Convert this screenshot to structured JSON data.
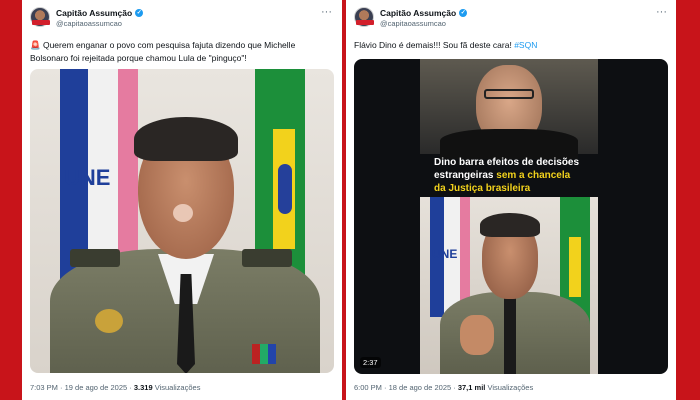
{
  "left_post": {
    "author": "Capitão Assumção",
    "handle": "@capitaoassumcao",
    "avatar_badge": "CAPITÃO",
    "emoji": "🚨",
    "text": "Querem enganar o povo com pesquisa fajuta dizendo que Michelle Bolsonaro foi rejeitada porque chamou Lula de \"pinguço\"!",
    "time": "7:03 PM · 19 de ago de 2025 ·",
    "views_count": "3.319",
    "views_label": "Visualizações",
    "flag_text": "UNE"
  },
  "right_post": {
    "author": "Capitão Assumção",
    "handle": "@capitaoassumcao",
    "text": "Flávio Dino é demais!!! Sou fã deste cara!",
    "hashtag": "#SQN",
    "caption_line1": "Dino barra efeitos de decisões",
    "caption_line2a": "estrangeiras ",
    "caption_line2b": "sem a chancela",
    "caption_line3": "da Justiça brasileira",
    "video_duration": "2:37",
    "time": "6:00 PM · 18 de ago de 2025 ·",
    "views_count": "37,1 mil",
    "views_label": "Visualizações",
    "flag_text": "UNE"
  },
  "colors": {
    "background": "#c8141a",
    "verified": "#1d9bf0",
    "hashtag": "#1d9bf0",
    "caption_highlight": "#f2d21c"
  }
}
